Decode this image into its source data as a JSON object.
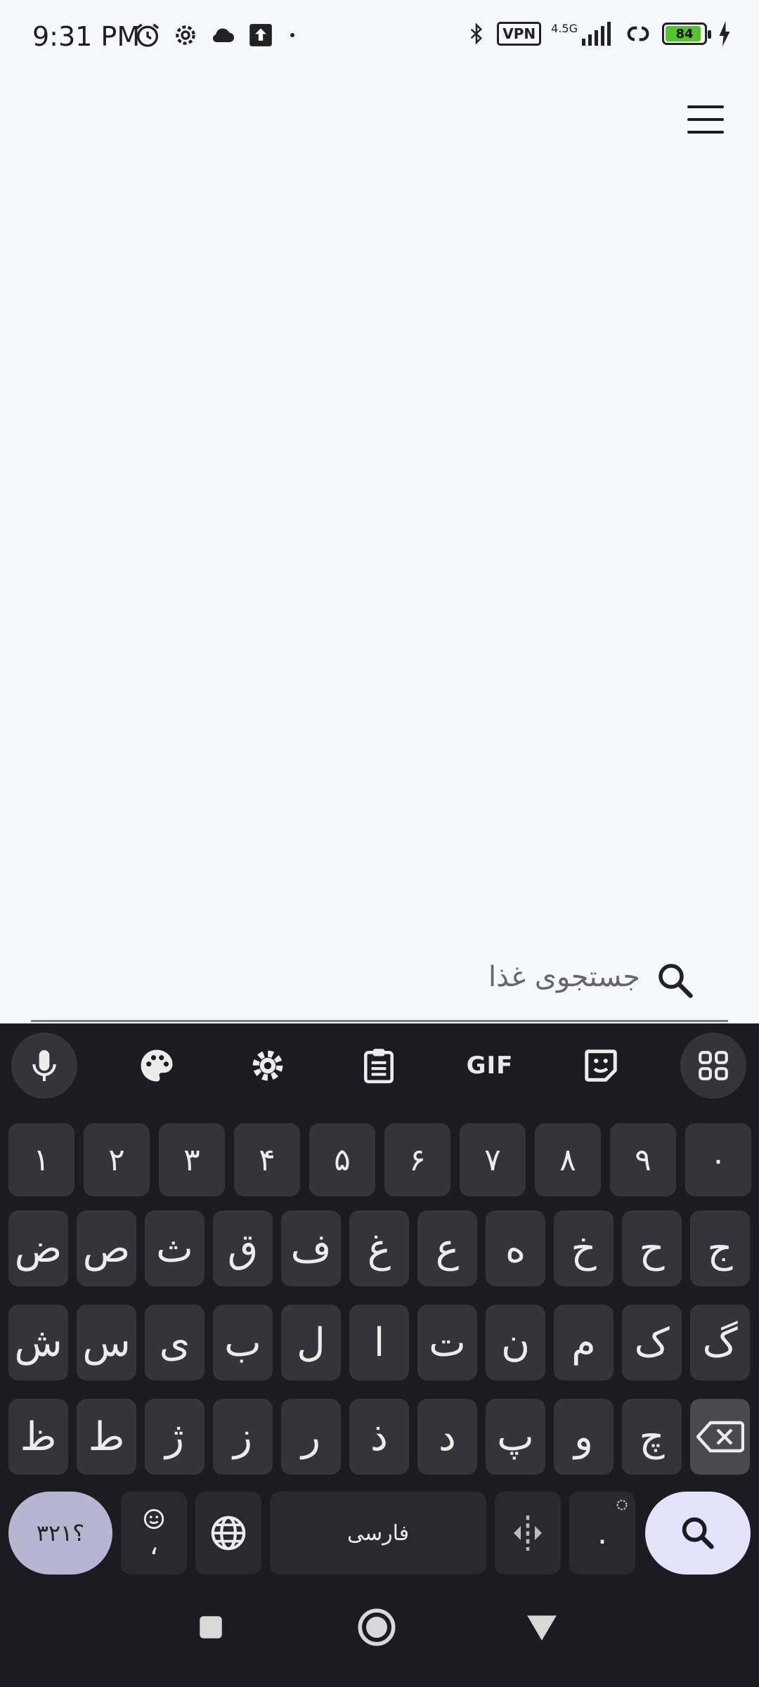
{
  "status_bar": {
    "time": "9:31 PM",
    "network": "4.5G",
    "vpn_label": "VPN",
    "battery": "84"
  },
  "search": {
    "placeholder": "جستجوی غذا"
  },
  "keyboard": {
    "toolbar": {
      "gif_label": "GIF"
    },
    "number_row": [
      "۱",
      "۲",
      "۳",
      "۴",
      "۵",
      "۶",
      "۷",
      "۸",
      "۹",
      "۰"
    ],
    "row1": [
      "ض",
      "ص",
      "ث",
      "ق",
      "ف",
      "غ",
      "ع",
      "ه",
      "خ",
      "ح",
      "ج"
    ],
    "row2": [
      "ش",
      "س",
      "ی",
      "ب",
      "ل",
      "ا",
      "ت",
      "ن",
      "م",
      "ک",
      "گ"
    ],
    "row3": [
      "ظ",
      "ط",
      "ژ",
      "ز",
      "ر",
      "ذ",
      "د",
      "پ",
      "و",
      "چ"
    ],
    "symbols_label": "؟۳۲۱",
    "comma_label": "،",
    "space_label": "فارسی",
    "period_label": "."
  },
  "colors": {
    "background": "#F7F8FC",
    "keyboard_bg": "#1c1b21",
    "key_bg": "#35343a",
    "accent_light": "#E5E3FB",
    "symbols_key": "#B8B5D0"
  }
}
